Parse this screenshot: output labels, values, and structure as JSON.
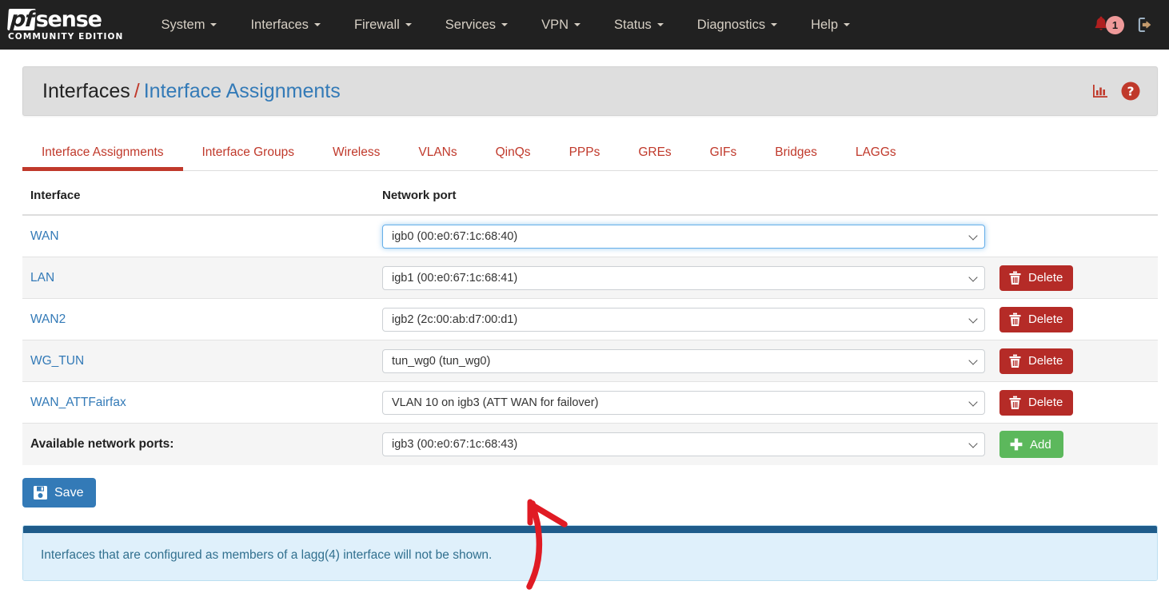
{
  "navbar": {
    "brand": {
      "logo_pf": "pf",
      "logo_sense": "sense",
      "subtitle": "COMMUNITY EDITION"
    },
    "menu": [
      {
        "label": "System"
      },
      {
        "label": "Interfaces"
      },
      {
        "label": "Firewall"
      },
      {
        "label": "Services"
      },
      {
        "label": "VPN"
      },
      {
        "label": "Status"
      },
      {
        "label": "Diagnostics"
      },
      {
        "label": "Help"
      }
    ],
    "notification_count": "1",
    "bell_icon": "bell-icon",
    "logout_icon": "logout-icon",
    "colors": {
      "bell": "#b01f1f",
      "badge_bg": "#ef9a9a"
    }
  },
  "page_header": {
    "breadcrumb_parent": "Interfaces",
    "breadcrumb_separator": "/",
    "breadcrumb_current": "Interface Assignments",
    "icons": [
      {
        "name": "stats-chart-icon",
        "color": "#c0392b"
      },
      {
        "name": "help-circle-icon",
        "color": "#c0392b"
      }
    ]
  },
  "tabs": [
    {
      "label": "Interface Assignments",
      "active": true
    },
    {
      "label": "Interface Groups",
      "active": false
    },
    {
      "label": "Wireless",
      "active": false
    },
    {
      "label": "VLANs",
      "active": false
    },
    {
      "label": "QinQs",
      "active": false
    },
    {
      "label": "PPPs",
      "active": false
    },
    {
      "label": "GREs",
      "active": false
    },
    {
      "label": "GIFs",
      "active": false
    },
    {
      "label": "Bridges",
      "active": false
    },
    {
      "label": "LAGGs",
      "active": false
    }
  ],
  "table": {
    "columns": {
      "interface": "Interface",
      "network_port": "Network port"
    },
    "rows": [
      {
        "interface": "WAN",
        "port_value": "igb0 (00:e0:67:1c:68:40)",
        "focused": true,
        "has_delete": false,
        "delete_label": ""
      },
      {
        "interface": "LAN",
        "port_value": "igb1 (00:e0:67:1c:68:41)",
        "focused": false,
        "has_delete": true,
        "delete_label": "Delete"
      },
      {
        "interface": "WAN2",
        "port_value": "igb2 (2c:00:ab:d7:00:d1)",
        "focused": false,
        "has_delete": true,
        "delete_label": "Delete"
      },
      {
        "interface": "WG_TUN",
        "port_value": "tun_wg0 (tun_wg0)",
        "focused": false,
        "has_delete": true,
        "delete_label": "Delete"
      },
      {
        "interface": "WAN_ATTFairfax",
        "port_value": "VLAN 10 on igb3 (ATT WAN for failover)",
        "focused": false,
        "has_delete": true,
        "delete_label": "Delete"
      }
    ],
    "available_row": {
      "label": "Available network ports:",
      "port_value": "igb3 (00:e0:67:1c:68:43)",
      "add_label": "Add"
    }
  },
  "save_button": {
    "label": "Save",
    "icon": "save-disk-icon",
    "color": "#337ab7"
  },
  "info_panel": {
    "text": "Interfaces that are configured as members of a lagg(4) interface will not be shown.",
    "accent_color": "#1f5c8b",
    "background_color": "#dff0fb"
  },
  "annotation": {
    "type": "hand-drawn-arrow",
    "color": "#e01b24",
    "description": "red arrow pointing up at the available network ports dropdown"
  }
}
